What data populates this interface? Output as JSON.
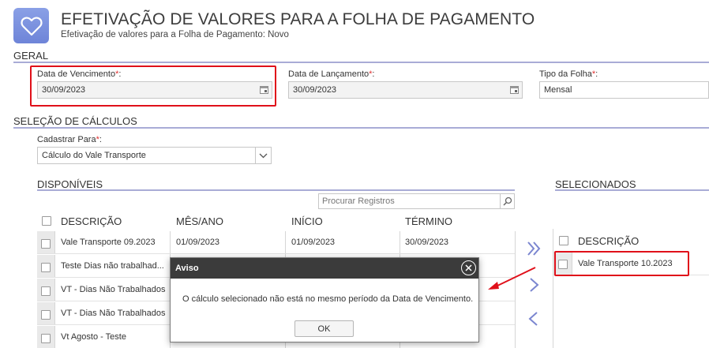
{
  "header": {
    "title": "EFETIVAÇÃO DE VALORES PARA A FOLHA DE PAGAMENTO",
    "subtitle": "Efetivação de valores para a Folha de Pagamento: Novo",
    "icon": "heart-icon",
    "icon_color": "#7a8fe0"
  },
  "geral": {
    "section_title": "GERAL",
    "data_vencimento": {
      "label": "Data de Vencimento",
      "value": "30/09/2023"
    },
    "data_lancamento": {
      "label": "Data de Lançamento",
      "value": "30/09/2023"
    },
    "tipo_folha": {
      "label": "Tipo da Folha",
      "value": "Mensal"
    },
    "required_mark": "*"
  },
  "selecao": {
    "section_title": "SELEÇÃO DE CÁLCULOS",
    "cadastrar_para": {
      "label": "Cadastrar Para",
      "value": "Cálculo do Vale Transporte"
    }
  },
  "disponiveis": {
    "title": "DISPONÍVEIS",
    "search_placeholder": "Procurar Registros",
    "columns": [
      "DESCRIÇÃO",
      "MÊS/ANO",
      "INÍCIO",
      "TÉRMINO"
    ],
    "rows": [
      {
        "descricao": "Vale Transporte 09.2023",
        "mes_ano": "01/09/2023",
        "inicio": "01/09/2023",
        "termino": "30/09/2023"
      },
      {
        "descricao": "Teste Dias não trabalhad...",
        "mes_ano": "",
        "inicio": "",
        "termino": ""
      },
      {
        "descricao": "VT - Dias Não Trabalhados",
        "mes_ano": "",
        "inicio": "",
        "termino": ""
      },
      {
        "descricao": "VT - Dias Não Trabalhados",
        "mes_ano": "",
        "inicio": "",
        "termino": ""
      },
      {
        "descricao": "Vt Agosto - Teste",
        "mes_ano": "",
        "inicio": "",
        "termino": ""
      }
    ]
  },
  "selecionados": {
    "title": "SELECIONADOS",
    "column": "DESCRIÇÃO",
    "rows": [
      {
        "descricao": "Vale Transporte 10.2023"
      }
    ]
  },
  "modal": {
    "title": "Aviso",
    "message": "O cálculo selecionado não está no mesmo período da Data de Vencimento.",
    "ok_label": "OK"
  },
  "colors": {
    "accent": "#7b86d0",
    "highlight_red": "#e0101a",
    "section_line": "#a9acd6",
    "modal_header": "#3b3b3b"
  }
}
